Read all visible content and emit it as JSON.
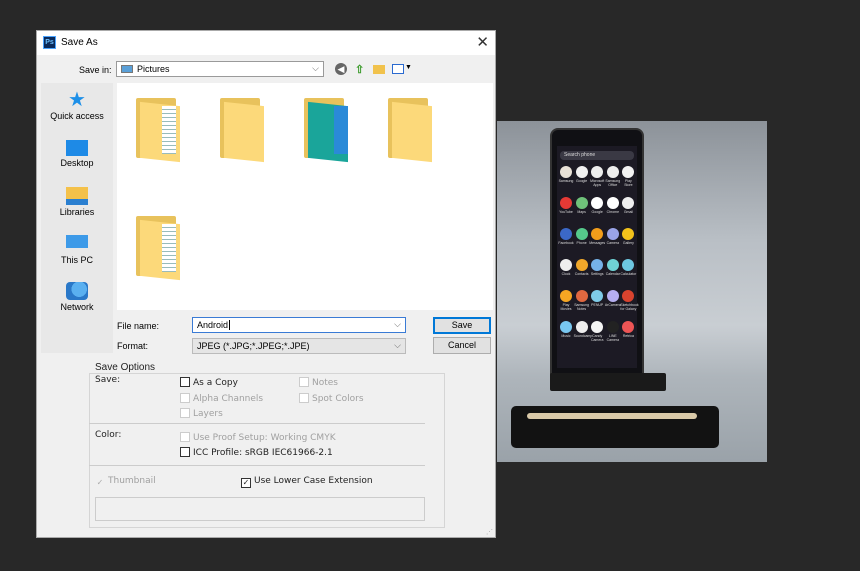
{
  "dialog": {
    "title": "Save As",
    "app_icon": "Ps",
    "close_icon": "close-icon",
    "save_in_label": "Save in:",
    "save_in_value": "Pictures",
    "toolbar_icons": [
      "back-icon",
      "up-folder-icon",
      "new-folder-icon",
      "view-menu-icon"
    ],
    "sidebar": [
      {
        "label": "Quick access",
        "icon": "star-icon"
      },
      {
        "label": "Desktop",
        "icon": "desktop-icon"
      },
      {
        "label": "Libraries",
        "icon": "libraries-icon"
      },
      {
        "label": "This PC",
        "icon": "computer-icon"
      },
      {
        "label": "Network",
        "icon": "network-icon"
      }
    ],
    "file_name_label": "File name:",
    "file_name_value": "Android",
    "format_label": "Format:",
    "format_value": "JPEG (*.JPG;*.JPEG;*.JPE)",
    "save_button": "Save",
    "cancel_button": "Cancel",
    "save_options": {
      "title": "Save Options",
      "save_label": "Save:",
      "as_a_copy": {
        "label": "As a Copy",
        "checked": false,
        "enabled": true
      },
      "notes": {
        "label": "Notes",
        "checked": false,
        "enabled": false
      },
      "alpha_channels": {
        "label": "Alpha Channels",
        "checked": false,
        "enabled": false
      },
      "spot_colors": {
        "label": "Spot Colors",
        "checked": false,
        "enabled": false
      },
      "layers": {
        "label": "Layers",
        "checked": false,
        "enabled": false
      },
      "color_label": "Color:",
      "use_proof_setup": {
        "label": "Use Proof Setup:  Working CMYK",
        "checked": false,
        "enabled": false
      },
      "icc_profile": {
        "label": "ICC Profile:  sRGB IEC61966-2.1",
        "checked": false,
        "enabled": true
      },
      "thumbnail": {
        "label": "Thumbnail",
        "checked": true,
        "enabled": false
      },
      "lower_case_ext": {
        "label": "Use Lower Case Extension",
        "checked": true,
        "enabled": true
      }
    }
  },
  "photo": {
    "search_text": "Search phone",
    "apps": [
      "Samsung",
      "Google",
      "Microsoft Apps",
      "Samsung Office",
      "Play Store",
      "YouTube",
      "Maps",
      "Google",
      "Chrome",
      "Gmail",
      "Facebook",
      "Phone",
      "Messages",
      "Camera",
      "Gallery",
      "Clock",
      "Contacts",
      "Settings",
      "Calendar",
      "Calculator",
      "Play Movies",
      "Samsung Notes",
      "PENUP",
      "ArCamera",
      "Sketchbook for Galaxy",
      "Music",
      "Soundcamp",
      "Candy Camera",
      "LINE Camera",
      "Retrica"
    ],
    "app_colors": [
      "#e9e2d8",
      "#f1f1f1",
      "#eee",
      "#eee",
      "#f2f2f2",
      "#e53935",
      "#6fc27a",
      "#fff",
      "#fff",
      "#eee",
      "#3b68c7",
      "#55c98b",
      "#f29d1b",
      "#9aa4e8",
      "#f2c21b",
      "#eee",
      "#f0a72a",
      "#75b2e8",
      "#6fd3d6",
      "#6dc7e0",
      "#f6a623",
      "#e06840",
      "#7ecbe8",
      "#b5aef0",
      "#d9432e",
      "#79c7f0",
      "#eee",
      "#f4f4f4",
      "#222",
      "#e55"
    ]
  }
}
